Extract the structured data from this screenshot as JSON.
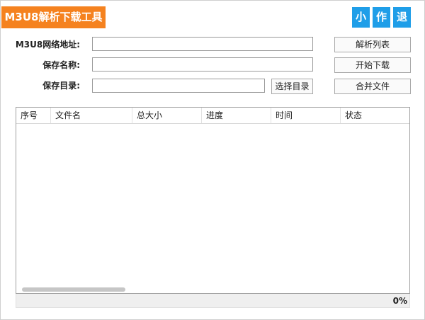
{
  "app": {
    "title": "M3U8解析下载工具",
    "window_buttons": [
      "小",
      "作",
      "退"
    ]
  },
  "form": {
    "url_label": "M3U8网络地址:",
    "url_value": "",
    "name_label": "保存名称:",
    "name_value": "",
    "dir_label": "保存目录:",
    "dir_value": "",
    "choose_dir_button": "选择目录"
  },
  "actions": {
    "parse_list": "解析列表",
    "start_download": "开始下载",
    "merge_files": "合并文件"
  },
  "table": {
    "columns": [
      "序号",
      "文件名",
      "总大小",
      "进度",
      "时间",
      "状态"
    ],
    "rows": []
  },
  "status": {
    "progress_text": "0%"
  },
  "colors": {
    "title_bg": "#f5821f",
    "window_button_bg": "#1f9ee8"
  }
}
